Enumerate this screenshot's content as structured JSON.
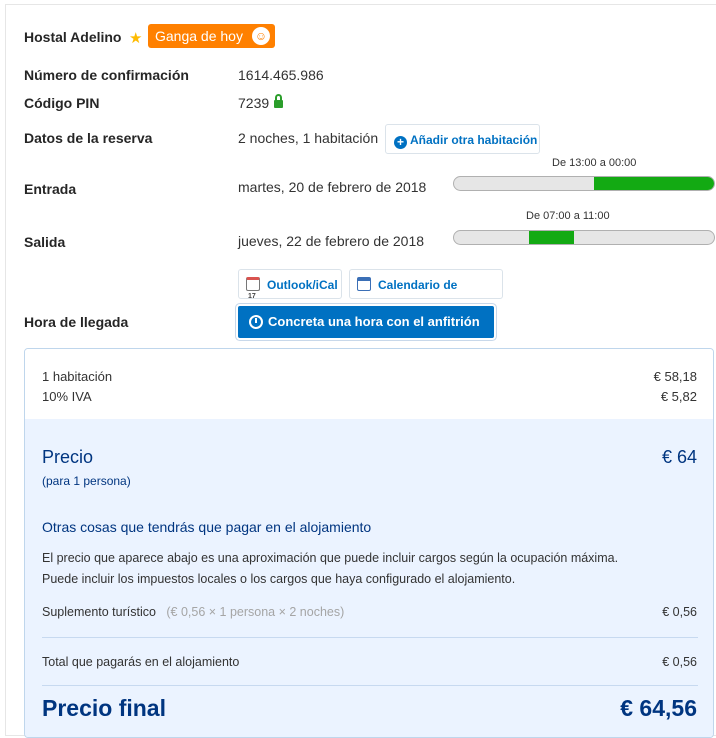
{
  "hotel": {
    "name": "Hostal Adelino",
    "deal_label": "Ganga de hoy"
  },
  "booking": {
    "confirmation_label": "Número de confirmación",
    "confirmation_value": "1614.465.986",
    "pin_label": "Código PIN",
    "pin_value": "7239",
    "details_label": "Datos de la reserva",
    "details_value": "2 noches, 1 habitación",
    "add_room_label": "Añadir otra habitación",
    "checkin_label": "Entrada",
    "checkin_value": "martes, 20 de febrero de 2018",
    "checkin_window": "De 13:00 a 00:00",
    "checkin_fill": {
      "start": 0.54,
      "end": 1.0
    },
    "checkout_label": "Salida",
    "checkout_value": "jueves, 22 de febrero de 2018",
    "checkout_window": "De 07:00 a 11:00",
    "checkout_fill": {
      "start": 0.29,
      "end": 0.46
    },
    "outlook_label": "Outlook/iCal",
    "google_label": "Calendario de Google",
    "arrival_label": "Hora de llegada",
    "arrival_button": "Concreta una hora con el anfitrión"
  },
  "price": {
    "room_label": "1 habitación",
    "room_value": "€ 58,18",
    "vat_label": "10% IVA",
    "vat_value": "€ 5,82",
    "price_label": "Precio",
    "price_value": "€ 64",
    "per_person": "(para 1 persona)",
    "extra_title": "Otras cosas que tendrás que pagar en el alojamiento",
    "extra_desc_1": "El precio que aparece abajo es una aproximación que puede incluir cargos según la ocupación máxima.",
    "extra_desc_2": "Puede incluir los impuestos locales o los cargos que haya configurado el alojamiento.",
    "tourist_label": "Suplemento turístico",
    "tourist_detail": "(€ 0,56 × 1 persona × 2 noches)",
    "tourist_value": "€ 0,56",
    "total_label": "Total que pagarás en el alojamiento",
    "total_value": "€ 0,56",
    "final_label": "Precio final",
    "final_value": "€ 64,56"
  },
  "colors": {
    "accent": "#0071c2",
    "deal": "#ff8000",
    "bar_fill": "#13aa13",
    "heading": "#003580"
  }
}
